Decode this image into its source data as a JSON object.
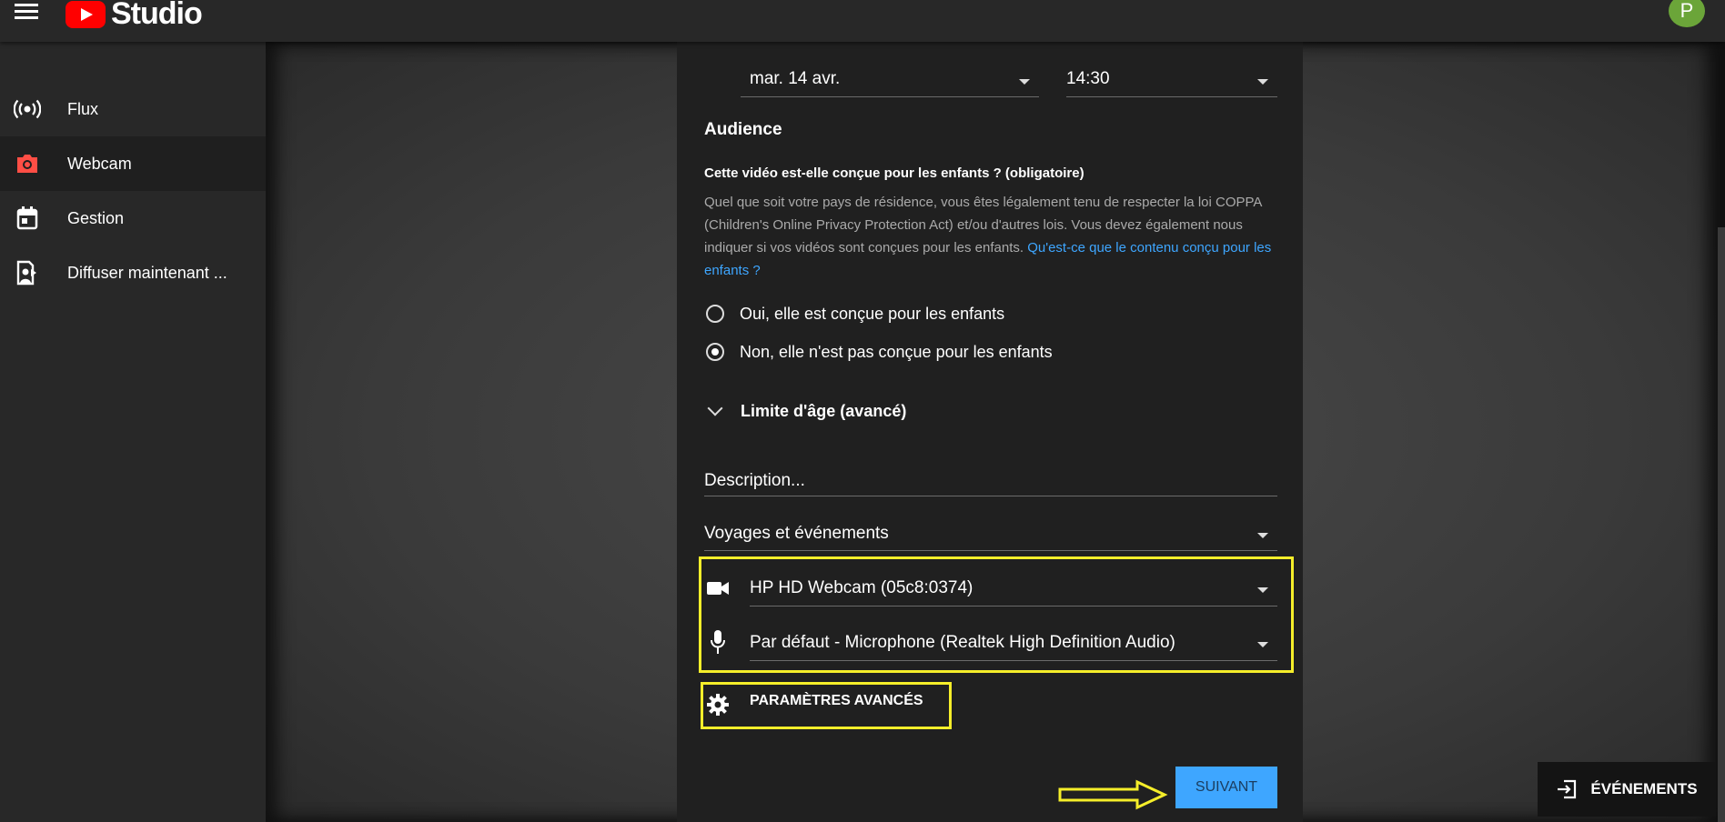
{
  "header": {
    "logo_text": "Studio",
    "avatar_letter": "P"
  },
  "sidebar": {
    "items": [
      {
        "label": "Flux",
        "icon": "broadcast-icon",
        "active": false
      },
      {
        "label": "Webcam",
        "icon": "camera-icon",
        "active": true
      },
      {
        "label": "Gestion",
        "icon": "calendar-icon",
        "active": false
      },
      {
        "label": "Diffuser maintenant ...",
        "icon": "stream-now-icon",
        "active": false
      }
    ]
  },
  "form": {
    "date": "mar. 14 avr.",
    "time": "14:30",
    "audience_heading": "Audience",
    "question": "Cette vidéo est-elle conçue pour les enfants ? (obligatoire)",
    "paragraph": "Quel que soit votre pays de résidence, vous êtes légalement tenu de respecter la loi COPPA (Children's Online Privacy Protection Act) et/ou d'autres lois. Vous devez également nous indiquer si vos vidéos sont conçues pour les enfants.",
    "link_text": "Qu'est-ce que le contenu conçu pour les enfants ?",
    "radio_yes": "Oui, elle est conçue pour les enfants",
    "radio_no": "Non, elle n'est pas conçue pour les enfants",
    "radio_selected": "no",
    "age_limit": "Limite d'âge (avancé)",
    "description_placeholder": "Description...",
    "category": "Voyages et événements",
    "camera": "HP HD Webcam (05c8:0374)",
    "microphone": "Par défaut - Microphone (Realtek High Definition Audio)",
    "advanced_settings": "PARAMÈTRES AVANCÉS",
    "next_button": "SUIVANT"
  },
  "events_button": "ÉVÉNEMENTS",
  "colors": {
    "accent": "#3ea6ff",
    "highlight": "#f5ee2a",
    "brand": "#ff0000",
    "avatar": "#6ba539"
  }
}
